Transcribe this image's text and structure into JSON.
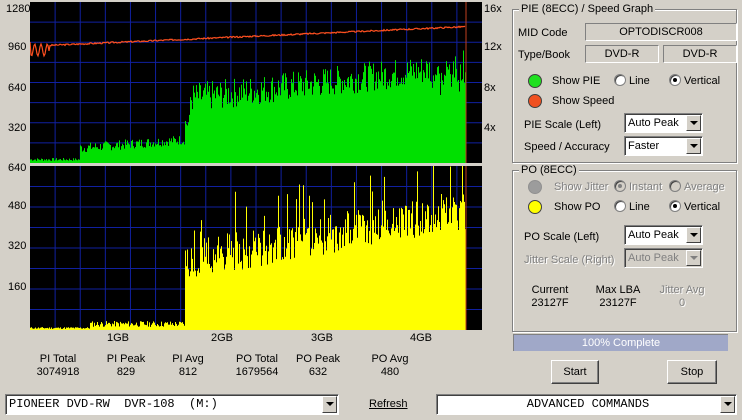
{
  "pie_graph": {
    "left_ticks": [
      "1280",
      "960",
      "640",
      "320",
      "640"
    ],
    "right_ticks": [
      "16x",
      "12x",
      "8x",
      "4x"
    ]
  },
  "po_graph": {
    "left_ticks": [
      "480",
      "320",
      "160"
    ]
  },
  "x_ticks": [
    "1GB",
    "2GB",
    "3GB",
    "4GB"
  ],
  "stats": [
    {
      "label": "PI Total",
      "value": "3074918"
    },
    {
      "label": "PI Peak",
      "value": "829"
    },
    {
      "label": "PI Avg",
      "value": "812"
    },
    {
      "label": "PO Total",
      "value": "1679564"
    },
    {
      "label": "PO Peak",
      "value": "632"
    },
    {
      "label": "PO Avg",
      "value": "480"
    }
  ],
  "pie_panel": {
    "title": "PIE (8ECC) / Speed Graph",
    "mid_label": "MID Code",
    "mid_value": "OPTODISCR008",
    "type_label": "Type/Book",
    "type_value": "DVD-R",
    "book_value": "DVD-R",
    "show_pie": "Show PIE",
    "show_speed": "Show Speed",
    "line": "Line",
    "vertical": "Vertical",
    "scale_label": "PIE Scale (Left)",
    "scale_value": "Auto Peak",
    "speed_label": "Speed / Accuracy",
    "speed_value": "Faster",
    "pie_color": "#00e000",
    "speed_color": "#ff5020"
  },
  "po_panel": {
    "title": "PO (8ECC)",
    "show_jitter": "Show Jitter",
    "instant": "Instant",
    "average": "Average",
    "show_po": "Show PO",
    "line": "Line",
    "vertical": "Vertical",
    "po_scale_label": "PO Scale (Left)",
    "po_scale_value": "Auto Peak",
    "jitter_scale_label": "Jitter Scale (Right)",
    "jitter_scale_value": "Auto Peak",
    "current_label": "Current",
    "current_value": "23127F",
    "maxlba_label": "Max LBA",
    "maxlba_value": "23127F",
    "jitter_avg_label": "Jitter Avg",
    "jitter_avg_value": "0",
    "po_color": "#ffff00"
  },
  "progress": {
    "text": "100% Complete",
    "fraction": 1.0
  },
  "buttons": {
    "start": "Start",
    "stop": "Stop",
    "refresh": "Refresh"
  },
  "drive": {
    "value": "PIONEER DVD-RW  DVR-108  (M:)"
  },
  "commands": {
    "value": "ADVANCED COMMANDS"
  }
}
